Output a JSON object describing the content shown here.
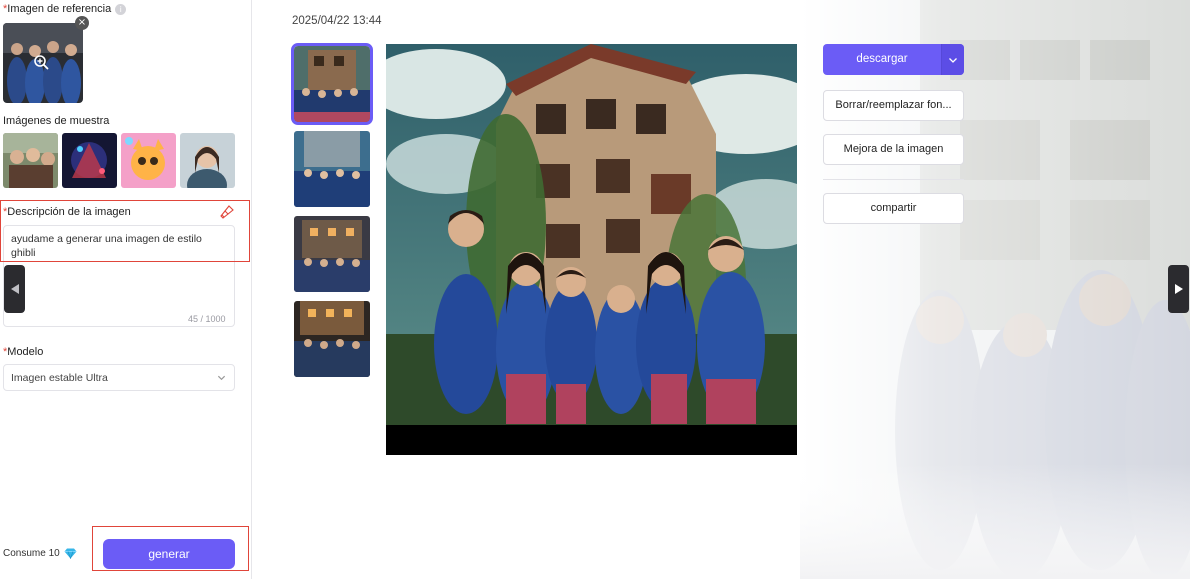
{
  "left_panel": {
    "reference_label": "Imagen de referencia",
    "reference_info_glyph": "i",
    "reference_close_glyph": "×",
    "samples_label": "Imágenes de muestra",
    "description_label": "Descripción de la imagen",
    "description_text": "ayudame a generar una imagen de estilo ghibli",
    "char_counter": "45 / 1000",
    "model_label": "Modelo",
    "model_value": "Imagen estable Ultra",
    "consume_text": "Consume 10",
    "generate_label": "generar",
    "required_mark": "*"
  },
  "main": {
    "timestamp": "2025/04/22 13:44",
    "download_label": "descargar",
    "remove_bg_label": "Borrar/reemplazar fon...",
    "enhance_label": "Mejora de la imagen",
    "share_label": "compartir"
  },
  "icons": [
    "info-icon",
    "close-icon",
    "zoom-icon",
    "brush-icon",
    "chevron-down-icon",
    "diamond-icon",
    "arrow-left-icon",
    "arrow-right-icon"
  ],
  "colors": {
    "accent": "#6b5cf6",
    "required": "#e0453a",
    "highlight_border": "#e0453a"
  }
}
